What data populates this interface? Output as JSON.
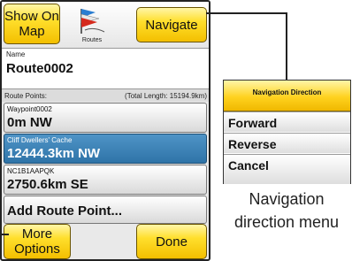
{
  "screen": {
    "show_on_map": "Show On Map",
    "routes_label": "Routes",
    "navigate": "Navigate",
    "name_label": "Name",
    "name_value": "Route0002",
    "route_points_label": "Route Points:",
    "total_length": "(Total Length: 15194.9km)",
    "points": [
      {
        "name": "Waypoint0002",
        "info": "0m NW",
        "selected": false
      },
      {
        "name": "Cliff Dwellers' Cache",
        "info": "12444.3km NW",
        "selected": true
      },
      {
        "name": "NC1B1AAPQK",
        "info": "2750.6km SE",
        "selected": false
      }
    ],
    "add_route_point": "Add Route Point...",
    "more_options": "More Options",
    "done": "Done"
  },
  "menu": {
    "title": "Navigation Direction",
    "items": [
      "Forward",
      "Reverse",
      "Cancel"
    ]
  },
  "caption": "Navigation direction menu"
}
